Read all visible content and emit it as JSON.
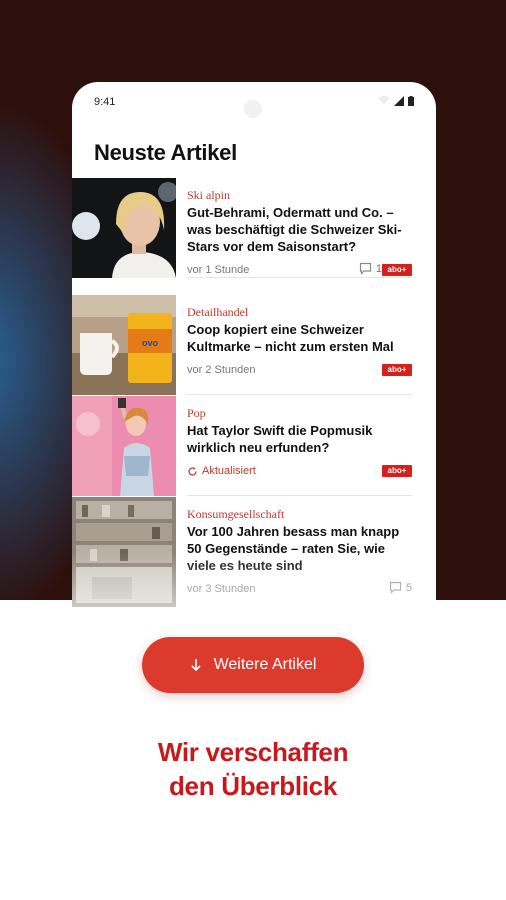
{
  "status_bar": {
    "time": "9:41"
  },
  "page": {
    "title": "Neuste Artikel"
  },
  "articles": [
    {
      "category": "Ski alpin",
      "headline": "Gut-Behrami, Odermatt und Co. – was beschäftigt die Schweizer Ski-Stars vor dem Saisonstart?",
      "time": "vor 1 Stunde",
      "comments": "1",
      "abo": "abo+"
    },
    {
      "category": "Detailhandel",
      "headline": "Coop kopiert eine Schweizer Kultmarke – nicht zum ersten Mal",
      "time": "vor 2 Stunden",
      "abo": "abo+"
    },
    {
      "category": "Pop",
      "headline": "Hat Taylor Swift die Popmusik wirklich neu erfunden?",
      "updated": "Aktualisiert",
      "abo": "abo+"
    },
    {
      "category": "Konsumgesellschaft",
      "headline": "Vor 100 Jahren besass man knapp 50 Gegenstände – raten Sie, wie viele es heute sind",
      "time": "vor 3 Stunden",
      "comments": "5"
    }
  ],
  "more_button": {
    "label": "Weitere Artikel"
  },
  "tagline": {
    "line1": "Wir verschaffen",
    "line2": "den Überblick"
  },
  "colors": {
    "accent": "#db3a2c",
    "brand_red": "#c8181c",
    "background_dark": "#2d0f0c"
  }
}
